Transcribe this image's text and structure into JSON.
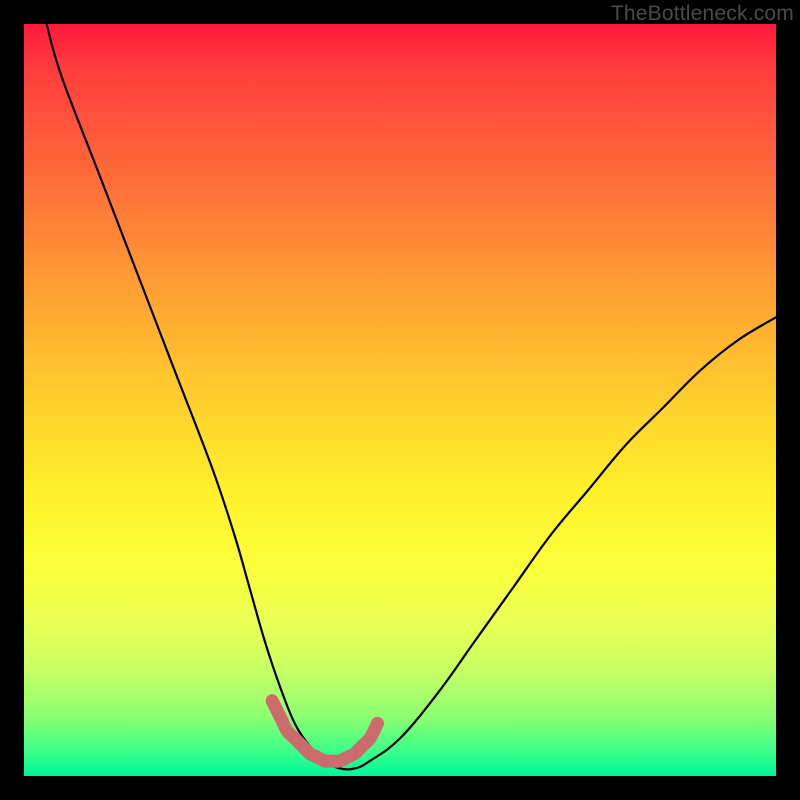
{
  "watermark": "TheBottleneck.com",
  "chart_data": {
    "type": "line",
    "title": "",
    "xlabel": "",
    "ylabel": "",
    "xlim": [
      0,
      100
    ],
    "ylim": [
      0,
      100
    ],
    "series": [
      {
        "name": "main-curve",
        "color": "#000000",
        "x": [
          3,
          5,
          10,
          15,
          20,
          25,
          28,
          30,
          32,
          34,
          36,
          38,
          40,
          42,
          44,
          46,
          50,
          55,
          60,
          65,
          70,
          75,
          80,
          85,
          90,
          95,
          100
        ],
        "values": [
          100,
          93,
          80,
          67,
          54,
          41,
          32,
          25,
          18,
          12,
          7,
          4,
          2,
          1,
          1,
          2,
          5,
          11,
          18,
          25,
          32,
          38,
          44,
          49,
          54,
          58,
          61
        ]
      },
      {
        "name": "bottom-highlight",
        "color": "#cc6b6b",
        "x": [
          33,
          34,
          35,
          36,
          37,
          38,
          39,
          40,
          41,
          42,
          43,
          44,
          45,
          46,
          47
        ],
        "values": [
          10,
          8,
          6,
          5,
          4,
          3,
          2.5,
          2,
          2,
          2,
          2.5,
          3,
          4,
          5,
          7
        ]
      }
    ]
  }
}
